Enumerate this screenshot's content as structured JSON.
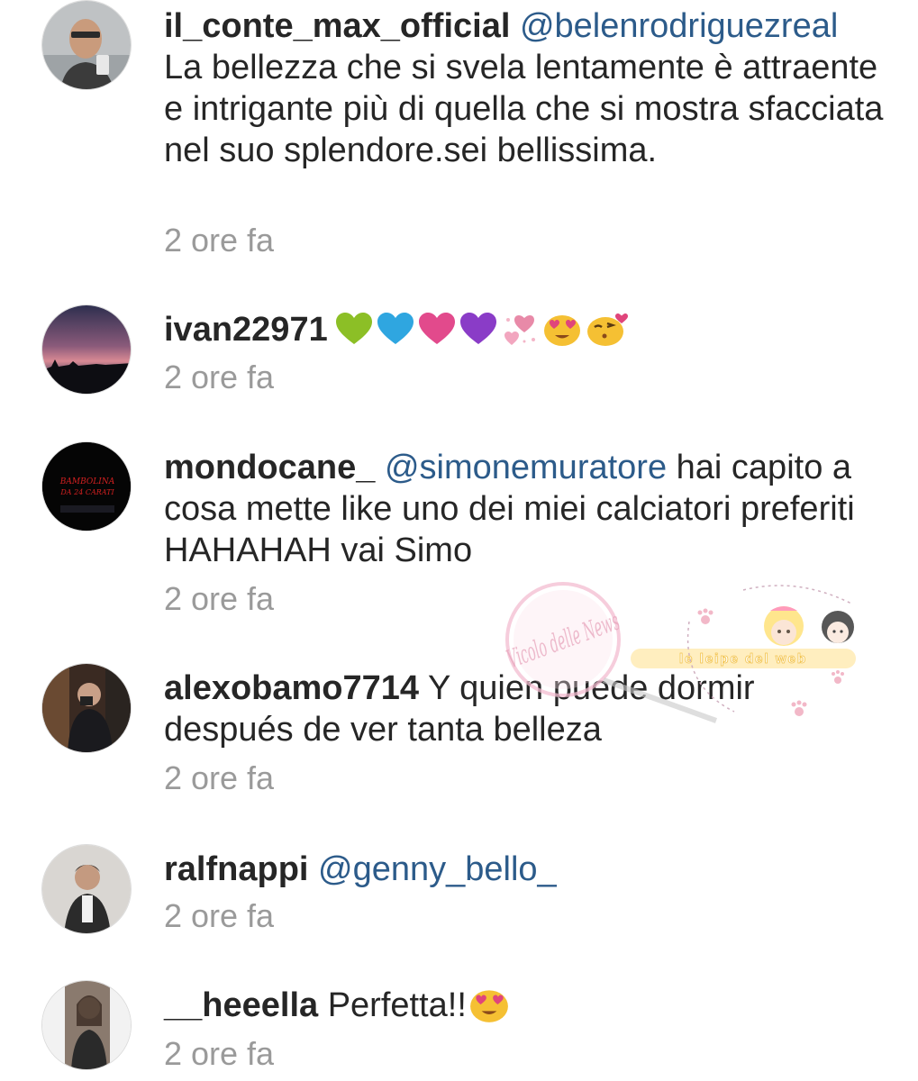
{
  "comments": [
    {
      "username": "il_conte_max_official",
      "mention": "@belenrodriguezreal",
      "text": "La bellezza che si svela lentamente è attraente e intrigante più di quella che si mostra sfacciata nel suo splendore.sei bellissima.",
      "time": "2 ore fa",
      "avatar": "avatar-man-selfie"
    },
    {
      "username": "ivan22971",
      "mention": "",
      "text": "",
      "emojis": [
        "green-heart-icon",
        "blue-heart-icon",
        "pink-heart-icon",
        "purple-heart-icon",
        "sparkling-hearts-icon",
        "heart-eyes-face-icon",
        "kissing-face-icon"
      ],
      "time": "2 ore fa",
      "avatar": "avatar-sunset-skyline"
    },
    {
      "username": "mondocane_",
      "mention": "@simonemuratore",
      "text": "hai capito a cosa mette like uno dei miei calciatori preferiti HAHAHAH vai Simo",
      "time": "2 ore fa",
      "avatar": "avatar-dark-text",
      "avatar_text": [
        "BAMBOLINA",
        "DA 24 CARATI"
      ]
    },
    {
      "username": "alexobamo7714",
      "mention": "",
      "text": "Y quien puede dormir después de ver tanta belleza",
      "time": "2 ore fa",
      "avatar": "avatar-mirror-selfie"
    },
    {
      "username": "ralfnappi",
      "mention": "@genny_bello_",
      "text": "",
      "time": "2 ore fa",
      "avatar": "avatar-young-man"
    },
    {
      "username": "__heeella",
      "mention": "",
      "text": "Perfetta!!",
      "emojis": [
        "heart-eyes-face-icon"
      ],
      "time": "2 ore fa",
      "avatar": "avatar-girl-photo"
    }
  ],
  "watermark": {
    "logo_text": "Vicolo delle News",
    "banner_text": "le leipe del web"
  },
  "colors": {
    "username": "#262626",
    "mention": "#2c5b8a",
    "text": "#262626",
    "timestamp": "#9a9a9a",
    "background": "#ffffff"
  }
}
